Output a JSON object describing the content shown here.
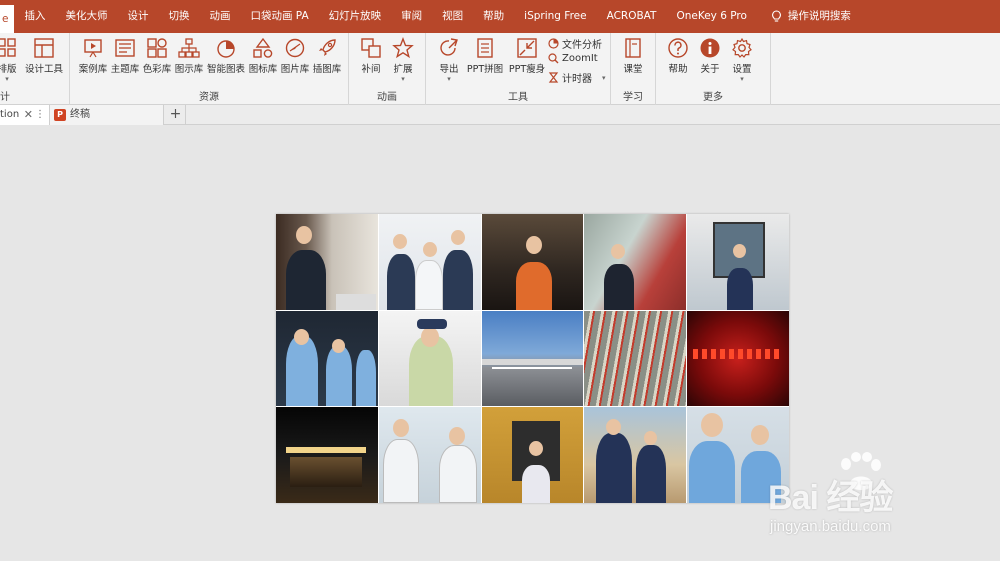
{
  "tabs": [
    {
      "label": "e"
    },
    {
      "label": "插入"
    },
    {
      "label": "美化大师"
    },
    {
      "label": "设计"
    },
    {
      "label": "切换"
    },
    {
      "label": "动画"
    },
    {
      "label": "口袋动画 PA"
    },
    {
      "label": "幻灯片放映"
    },
    {
      "label": "审阅"
    },
    {
      "label": "视图"
    },
    {
      "label": "帮助"
    },
    {
      "label": "iSpring Free"
    },
    {
      "label": "ACROBAT"
    },
    {
      "label": "OneKey 6 Pro"
    },
    {
      "label": "操作说明搜索"
    }
  ],
  "ribbon": {
    "design_group": {
      "label": "计",
      "buttons": [
        {
          "label": "排版"
        },
        {
          "label": "设计工具"
        }
      ]
    },
    "resource_group": {
      "label": "资源",
      "buttons": [
        {
          "label": "案例库"
        },
        {
          "label": "主题库"
        },
        {
          "label": "色彩库"
        },
        {
          "label": "图示库"
        },
        {
          "label": "智能图表"
        },
        {
          "label": "图标库"
        },
        {
          "label": "图片库"
        },
        {
          "label": "插图库"
        }
      ]
    },
    "animation_group": {
      "label": "动画",
      "buttons": [
        {
          "label": "补间"
        },
        {
          "label": "扩展"
        }
      ]
    },
    "tools_group": {
      "label": "工具",
      "buttons": [
        {
          "label": "导出"
        },
        {
          "label": "PPT拼图"
        },
        {
          "label": "PPT瘦身"
        }
      ],
      "small_buttons": [
        {
          "label": "文件分析"
        },
        {
          "label": "ZoomIt"
        },
        {
          "label": "计时器"
        }
      ]
    },
    "learn_group": {
      "label": "学习",
      "buttons": [
        {
          "label": "课堂"
        }
      ]
    },
    "more_group": {
      "label": "更多",
      "buttons": [
        {
          "label": "帮助"
        },
        {
          "label": "关于"
        },
        {
          "label": "设置"
        }
      ]
    }
  },
  "doc_tabs": [
    {
      "label": "tion"
    },
    {
      "label": "终稿"
    }
  ],
  "add_tab_label": "+",
  "watermark": {
    "brand": "Bai 经验",
    "url": "jingyan.baidu.com"
  },
  "colors": {
    "accent": "#b7472a",
    "ribbon_bg": "#f3f3f3",
    "canvas_bg": "#e6e6e6"
  }
}
